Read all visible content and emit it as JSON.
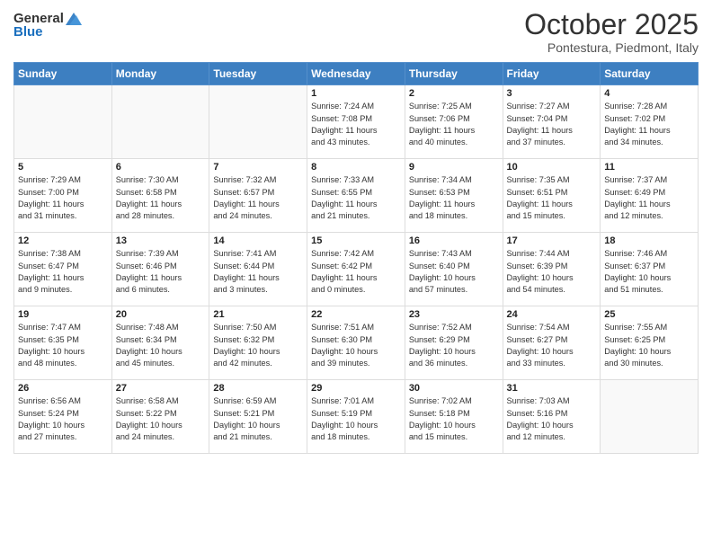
{
  "header": {
    "logo": {
      "general": "General",
      "blue": "Blue"
    },
    "title": "October 2025",
    "location": "Pontestura, Piedmont, Italy"
  },
  "calendar": {
    "weekdays": [
      "Sunday",
      "Monday",
      "Tuesday",
      "Wednesday",
      "Thursday",
      "Friday",
      "Saturday"
    ],
    "weeks": [
      [
        {
          "day": "",
          "info": ""
        },
        {
          "day": "",
          "info": ""
        },
        {
          "day": "",
          "info": ""
        },
        {
          "day": "1",
          "info": "Sunrise: 7:24 AM\nSunset: 7:08 PM\nDaylight: 11 hours\nand 43 minutes."
        },
        {
          "day": "2",
          "info": "Sunrise: 7:25 AM\nSunset: 7:06 PM\nDaylight: 11 hours\nand 40 minutes."
        },
        {
          "day": "3",
          "info": "Sunrise: 7:27 AM\nSunset: 7:04 PM\nDaylight: 11 hours\nand 37 minutes."
        },
        {
          "day": "4",
          "info": "Sunrise: 7:28 AM\nSunset: 7:02 PM\nDaylight: 11 hours\nand 34 minutes."
        }
      ],
      [
        {
          "day": "5",
          "info": "Sunrise: 7:29 AM\nSunset: 7:00 PM\nDaylight: 11 hours\nand 31 minutes."
        },
        {
          "day": "6",
          "info": "Sunrise: 7:30 AM\nSunset: 6:58 PM\nDaylight: 11 hours\nand 28 minutes."
        },
        {
          "day": "7",
          "info": "Sunrise: 7:32 AM\nSunset: 6:57 PM\nDaylight: 11 hours\nand 24 minutes."
        },
        {
          "day": "8",
          "info": "Sunrise: 7:33 AM\nSunset: 6:55 PM\nDaylight: 11 hours\nand 21 minutes."
        },
        {
          "day": "9",
          "info": "Sunrise: 7:34 AM\nSunset: 6:53 PM\nDaylight: 11 hours\nand 18 minutes."
        },
        {
          "day": "10",
          "info": "Sunrise: 7:35 AM\nSunset: 6:51 PM\nDaylight: 11 hours\nand 15 minutes."
        },
        {
          "day": "11",
          "info": "Sunrise: 7:37 AM\nSunset: 6:49 PM\nDaylight: 11 hours\nand 12 minutes."
        }
      ],
      [
        {
          "day": "12",
          "info": "Sunrise: 7:38 AM\nSunset: 6:47 PM\nDaylight: 11 hours\nand 9 minutes."
        },
        {
          "day": "13",
          "info": "Sunrise: 7:39 AM\nSunset: 6:46 PM\nDaylight: 11 hours\nand 6 minutes."
        },
        {
          "day": "14",
          "info": "Sunrise: 7:41 AM\nSunset: 6:44 PM\nDaylight: 11 hours\nand 3 minutes."
        },
        {
          "day": "15",
          "info": "Sunrise: 7:42 AM\nSunset: 6:42 PM\nDaylight: 11 hours\nand 0 minutes."
        },
        {
          "day": "16",
          "info": "Sunrise: 7:43 AM\nSunset: 6:40 PM\nDaylight: 10 hours\nand 57 minutes."
        },
        {
          "day": "17",
          "info": "Sunrise: 7:44 AM\nSunset: 6:39 PM\nDaylight: 10 hours\nand 54 minutes."
        },
        {
          "day": "18",
          "info": "Sunrise: 7:46 AM\nSunset: 6:37 PM\nDaylight: 10 hours\nand 51 minutes."
        }
      ],
      [
        {
          "day": "19",
          "info": "Sunrise: 7:47 AM\nSunset: 6:35 PM\nDaylight: 10 hours\nand 48 minutes."
        },
        {
          "day": "20",
          "info": "Sunrise: 7:48 AM\nSunset: 6:34 PM\nDaylight: 10 hours\nand 45 minutes."
        },
        {
          "day": "21",
          "info": "Sunrise: 7:50 AM\nSunset: 6:32 PM\nDaylight: 10 hours\nand 42 minutes."
        },
        {
          "day": "22",
          "info": "Sunrise: 7:51 AM\nSunset: 6:30 PM\nDaylight: 10 hours\nand 39 minutes."
        },
        {
          "day": "23",
          "info": "Sunrise: 7:52 AM\nSunset: 6:29 PM\nDaylight: 10 hours\nand 36 minutes."
        },
        {
          "day": "24",
          "info": "Sunrise: 7:54 AM\nSunset: 6:27 PM\nDaylight: 10 hours\nand 33 minutes."
        },
        {
          "day": "25",
          "info": "Sunrise: 7:55 AM\nSunset: 6:25 PM\nDaylight: 10 hours\nand 30 minutes."
        }
      ],
      [
        {
          "day": "26",
          "info": "Sunrise: 6:56 AM\nSunset: 5:24 PM\nDaylight: 10 hours\nand 27 minutes."
        },
        {
          "day": "27",
          "info": "Sunrise: 6:58 AM\nSunset: 5:22 PM\nDaylight: 10 hours\nand 24 minutes."
        },
        {
          "day": "28",
          "info": "Sunrise: 6:59 AM\nSunset: 5:21 PM\nDaylight: 10 hours\nand 21 minutes."
        },
        {
          "day": "29",
          "info": "Sunrise: 7:01 AM\nSunset: 5:19 PM\nDaylight: 10 hours\nand 18 minutes."
        },
        {
          "day": "30",
          "info": "Sunrise: 7:02 AM\nSunset: 5:18 PM\nDaylight: 10 hours\nand 15 minutes."
        },
        {
          "day": "31",
          "info": "Sunrise: 7:03 AM\nSunset: 5:16 PM\nDaylight: 10 hours\nand 12 minutes."
        },
        {
          "day": "",
          "info": ""
        }
      ]
    ]
  }
}
